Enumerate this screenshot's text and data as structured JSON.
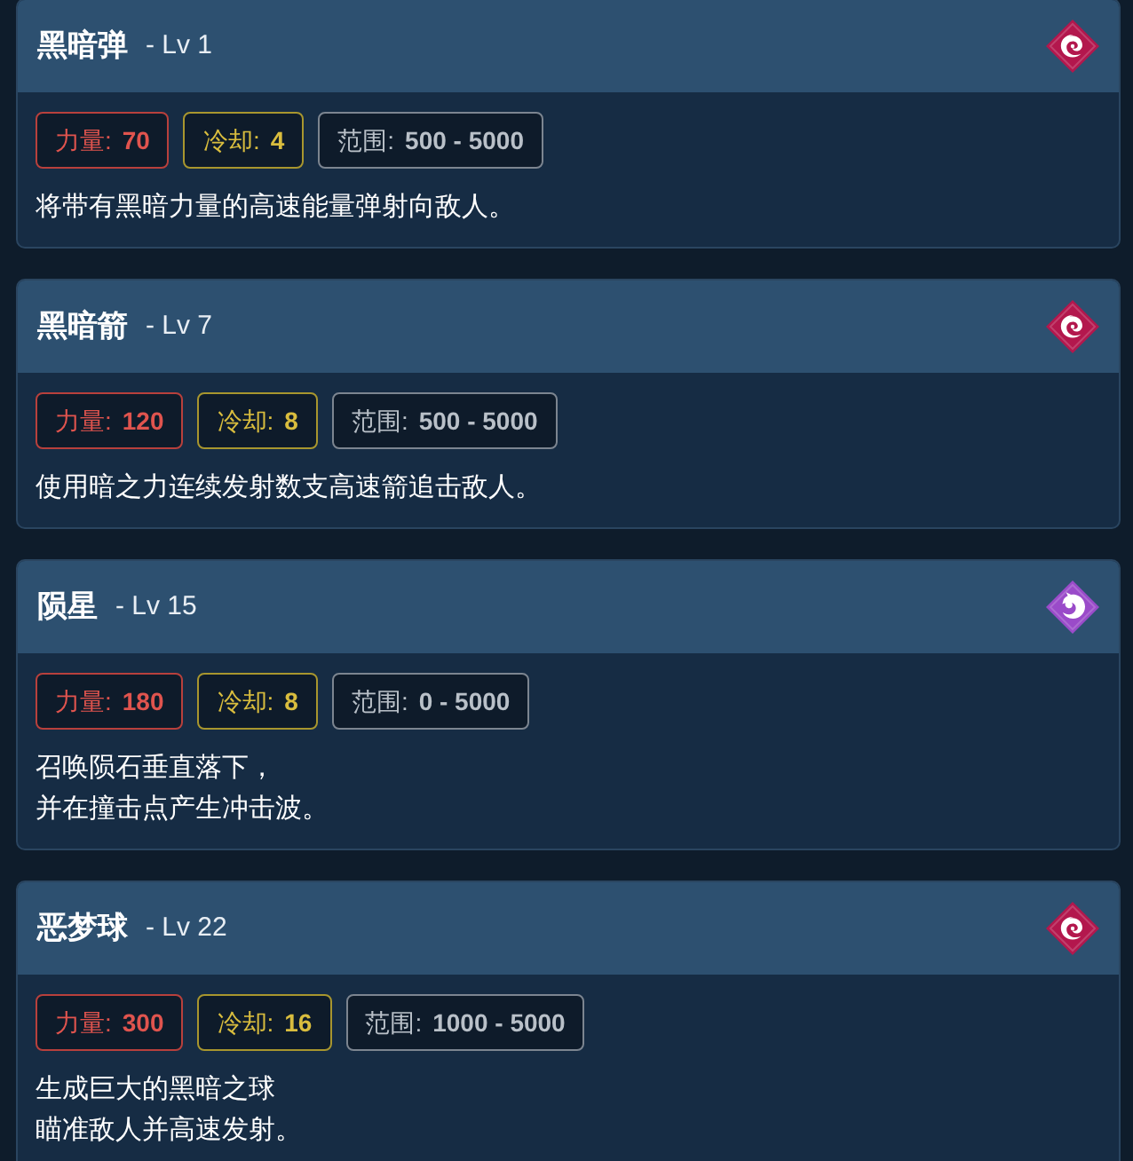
{
  "skills": [
    {
      "name": "黑暗弹",
      "level": "- Lv 1",
      "icon": {
        "kind": "spiral",
        "color": "#b3174d"
      },
      "stats": [
        {
          "kind": "power",
          "label": "力量:",
          "value": "70"
        },
        {
          "kind": "cooldown",
          "label": "冷却:",
          "value": "4"
        },
        {
          "kind": "range",
          "label": "范围:",
          "value": "500 - 5000"
        }
      ],
      "description": [
        "将带有黑暗力量的高速能量弹射向敌人。"
      ]
    },
    {
      "name": "黑暗箭",
      "level": "- Lv 7",
      "icon": {
        "kind": "spiral",
        "color": "#b3174d"
      },
      "stats": [
        {
          "kind": "power",
          "label": "力量:",
          "value": "120"
        },
        {
          "kind": "cooldown",
          "label": "冷却:",
          "value": "8"
        },
        {
          "kind": "range",
          "label": "范围:",
          "value": "500 - 5000"
        }
      ],
      "description": [
        "使用暗之力连续发射数支高速箭追击敌人。"
      ]
    },
    {
      "name": "陨星",
      "level": "- Lv 15",
      "icon": {
        "kind": "creature",
        "color": "#9a4bc9"
      },
      "stats": [
        {
          "kind": "power",
          "label": "力量:",
          "value": "180"
        },
        {
          "kind": "cooldown",
          "label": "冷却:",
          "value": "8"
        },
        {
          "kind": "range",
          "label": "范围:",
          "value": "0 - 5000"
        }
      ],
      "description": [
        "召唤陨石垂直落下，",
        "并在撞击点产生冲击波。"
      ]
    },
    {
      "name": "恶梦球",
      "level": "- Lv 22",
      "icon": {
        "kind": "spiral",
        "color": "#b3174d"
      },
      "stats": [
        {
          "kind": "power",
          "label": "力量:",
          "value": "300"
        },
        {
          "kind": "cooldown",
          "label": "冷却:",
          "value": "16"
        },
        {
          "kind": "range",
          "label": "范围:",
          "value": "1000 - 5000"
        }
      ],
      "description": [
        "生成巨大的黑暗之球",
        "瞄准敌人并高速发射。"
      ]
    }
  ]
}
